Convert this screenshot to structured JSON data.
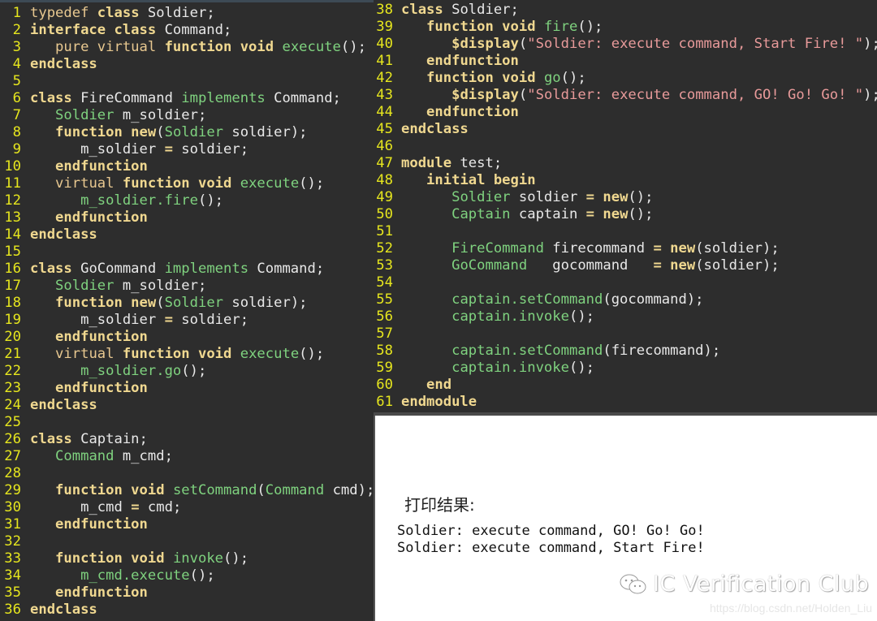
{
  "left_code": [
    {
      "n": "1",
      "parts": [
        {
          "c": "kw2",
          "t": "typedef "
        },
        {
          "c": "kw",
          "t": "class"
        },
        {
          "c": "plain",
          "t": " Soldier;"
        }
      ]
    },
    {
      "n": "2",
      "parts": [
        {
          "c": "kw",
          "t": "interface class"
        },
        {
          "c": "plain",
          "t": " Command;"
        }
      ]
    },
    {
      "n": "3",
      "parts": [
        {
          "c": "plain",
          "t": "   "
        },
        {
          "c": "kw2",
          "t": "pure virtual "
        },
        {
          "c": "kw",
          "t": "function void"
        },
        {
          "c": "plain",
          "t": " "
        },
        {
          "c": "fn",
          "t": "execute"
        },
        {
          "c": "plain",
          "t": "();"
        }
      ]
    },
    {
      "n": "4",
      "parts": [
        {
          "c": "kw",
          "t": "endclass"
        }
      ]
    },
    {
      "n": "5",
      "parts": []
    },
    {
      "n": "6",
      "parts": [
        {
          "c": "kw",
          "t": "class"
        },
        {
          "c": "plain",
          "t": " FireCommand "
        },
        {
          "c": "ty",
          "t": "implements"
        },
        {
          "c": "plain",
          "t": " Command;"
        }
      ]
    },
    {
      "n": "7",
      "parts": [
        {
          "c": "plain",
          "t": "   "
        },
        {
          "c": "ty",
          "t": "Soldier"
        },
        {
          "c": "plain",
          "t": " m_soldier;"
        }
      ]
    },
    {
      "n": "8",
      "parts": [
        {
          "c": "plain",
          "t": "   "
        },
        {
          "c": "kw",
          "t": "function new"
        },
        {
          "c": "plain",
          "t": "("
        },
        {
          "c": "ty",
          "t": "Soldier"
        },
        {
          "c": "plain",
          "t": " soldier);"
        }
      ]
    },
    {
      "n": "9",
      "parts": [
        {
          "c": "plain",
          "t": "      m_soldier "
        },
        {
          "c": "kw",
          "t": "="
        },
        {
          "c": "plain",
          "t": " soldier;"
        }
      ]
    },
    {
      "n": "10",
      "parts": [
        {
          "c": "plain",
          "t": "   "
        },
        {
          "c": "kw",
          "t": "endfunction"
        }
      ]
    },
    {
      "n": "11",
      "parts": [
        {
          "c": "plain",
          "t": "   "
        },
        {
          "c": "kw2",
          "t": "virtual "
        },
        {
          "c": "kw",
          "t": "function void"
        },
        {
          "c": "plain",
          "t": " "
        },
        {
          "c": "fn",
          "t": "execute"
        },
        {
          "c": "plain",
          "t": "();"
        }
      ]
    },
    {
      "n": "12",
      "parts": [
        {
          "c": "plain",
          "t": "      "
        },
        {
          "c": "fn",
          "t": "m_soldier.fire"
        },
        {
          "c": "plain",
          "t": "();"
        }
      ]
    },
    {
      "n": "13",
      "parts": [
        {
          "c": "plain",
          "t": "   "
        },
        {
          "c": "kw",
          "t": "endfunction"
        }
      ]
    },
    {
      "n": "14",
      "parts": [
        {
          "c": "kw",
          "t": "endclass"
        }
      ]
    },
    {
      "n": "15",
      "parts": []
    },
    {
      "n": "16",
      "parts": [
        {
          "c": "kw",
          "t": "class"
        },
        {
          "c": "plain",
          "t": " GoCommand "
        },
        {
          "c": "ty",
          "t": "implements"
        },
        {
          "c": "plain",
          "t": " Command;"
        }
      ]
    },
    {
      "n": "17",
      "parts": [
        {
          "c": "plain",
          "t": "   "
        },
        {
          "c": "ty",
          "t": "Soldier"
        },
        {
          "c": "plain",
          "t": " m_soldier;"
        }
      ]
    },
    {
      "n": "18",
      "parts": [
        {
          "c": "plain",
          "t": "   "
        },
        {
          "c": "kw",
          "t": "function new"
        },
        {
          "c": "plain",
          "t": "("
        },
        {
          "c": "ty",
          "t": "Soldier"
        },
        {
          "c": "plain",
          "t": " soldier);"
        }
      ]
    },
    {
      "n": "19",
      "parts": [
        {
          "c": "plain",
          "t": "      m_soldier "
        },
        {
          "c": "kw",
          "t": "="
        },
        {
          "c": "plain",
          "t": " soldier;"
        }
      ]
    },
    {
      "n": "20",
      "parts": [
        {
          "c": "plain",
          "t": "   "
        },
        {
          "c": "kw",
          "t": "endfunction"
        }
      ]
    },
    {
      "n": "21",
      "parts": [
        {
          "c": "plain",
          "t": "   "
        },
        {
          "c": "kw2",
          "t": "virtual "
        },
        {
          "c": "kw",
          "t": "function void"
        },
        {
          "c": "plain",
          "t": " "
        },
        {
          "c": "fn",
          "t": "execute"
        },
        {
          "c": "plain",
          "t": "();"
        }
      ]
    },
    {
      "n": "22",
      "parts": [
        {
          "c": "plain",
          "t": "      "
        },
        {
          "c": "fn",
          "t": "m_soldier.go"
        },
        {
          "c": "plain",
          "t": "();"
        }
      ]
    },
    {
      "n": "23",
      "parts": [
        {
          "c": "plain",
          "t": "   "
        },
        {
          "c": "kw",
          "t": "endfunction"
        }
      ]
    },
    {
      "n": "24",
      "parts": [
        {
          "c": "kw",
          "t": "endclass"
        }
      ]
    },
    {
      "n": "25",
      "parts": []
    },
    {
      "n": "26",
      "parts": [
        {
          "c": "kw",
          "t": "class"
        },
        {
          "c": "plain",
          "t": " Captain;"
        }
      ]
    },
    {
      "n": "27",
      "parts": [
        {
          "c": "plain",
          "t": "   "
        },
        {
          "c": "ty",
          "t": "Command"
        },
        {
          "c": "plain",
          "t": " m_cmd;"
        }
      ]
    },
    {
      "n": "28",
      "parts": []
    },
    {
      "n": "29",
      "parts": [
        {
          "c": "plain",
          "t": "   "
        },
        {
          "c": "kw",
          "t": "function void"
        },
        {
          "c": "plain",
          "t": " "
        },
        {
          "c": "fn",
          "t": "setCommand"
        },
        {
          "c": "plain",
          "t": "("
        },
        {
          "c": "ty",
          "t": "Command"
        },
        {
          "c": "plain",
          "t": " cmd);"
        }
      ]
    },
    {
      "n": "30",
      "parts": [
        {
          "c": "plain",
          "t": "      m_cmd "
        },
        {
          "c": "kw",
          "t": "="
        },
        {
          "c": "plain",
          "t": " cmd;"
        }
      ]
    },
    {
      "n": "31",
      "parts": [
        {
          "c": "plain",
          "t": "   "
        },
        {
          "c": "kw",
          "t": "endfunction"
        }
      ]
    },
    {
      "n": "32",
      "parts": []
    },
    {
      "n": "33",
      "parts": [
        {
          "c": "plain",
          "t": "   "
        },
        {
          "c": "kw",
          "t": "function void"
        },
        {
          "c": "plain",
          "t": " "
        },
        {
          "c": "fn",
          "t": "invoke"
        },
        {
          "c": "plain",
          "t": "();"
        }
      ]
    },
    {
      "n": "34",
      "parts": [
        {
          "c": "plain",
          "t": "      "
        },
        {
          "c": "fn",
          "t": "m_cmd.execute"
        },
        {
          "c": "plain",
          "t": "();"
        }
      ]
    },
    {
      "n": "35",
      "parts": [
        {
          "c": "plain",
          "t": "   "
        },
        {
          "c": "kw",
          "t": "endfunction"
        }
      ]
    },
    {
      "n": "36",
      "parts": [
        {
          "c": "kw",
          "t": "endclass"
        }
      ]
    }
  ],
  "right_code": [
    {
      "n": "38",
      "parts": [
        {
          "c": "kw",
          "t": "class"
        },
        {
          "c": "plain",
          "t": " Soldier;"
        }
      ]
    },
    {
      "n": "39",
      "parts": [
        {
          "c": "plain",
          "t": "   "
        },
        {
          "c": "kw",
          "t": "function void"
        },
        {
          "c": "plain",
          "t": " "
        },
        {
          "c": "fn",
          "t": "fire"
        },
        {
          "c": "plain",
          "t": "();"
        }
      ]
    },
    {
      "n": "40",
      "parts": [
        {
          "c": "plain",
          "t": "      "
        },
        {
          "c": "kw",
          "t": "$display"
        },
        {
          "c": "plain",
          "t": "("
        },
        {
          "c": "str",
          "t": "\"Soldier: execute command, Start Fire! \""
        },
        {
          "c": "plain",
          "t": ");"
        }
      ]
    },
    {
      "n": "41",
      "parts": [
        {
          "c": "plain",
          "t": "   "
        },
        {
          "c": "kw",
          "t": "endfunction"
        }
      ]
    },
    {
      "n": "42",
      "parts": [
        {
          "c": "plain",
          "t": "   "
        },
        {
          "c": "kw",
          "t": "function void"
        },
        {
          "c": "plain",
          "t": " "
        },
        {
          "c": "fn",
          "t": "go"
        },
        {
          "c": "plain",
          "t": "();"
        }
      ]
    },
    {
      "n": "43",
      "parts": [
        {
          "c": "plain",
          "t": "      "
        },
        {
          "c": "kw",
          "t": "$display"
        },
        {
          "c": "plain",
          "t": "("
        },
        {
          "c": "str",
          "t": "\"Soldier: execute command, GO! Go! Go! \""
        },
        {
          "c": "plain",
          "t": ");"
        }
      ]
    },
    {
      "n": "44",
      "parts": [
        {
          "c": "plain",
          "t": "   "
        },
        {
          "c": "kw",
          "t": "endfunction"
        }
      ]
    },
    {
      "n": "45",
      "parts": [
        {
          "c": "kw",
          "t": "endclass"
        }
      ]
    },
    {
      "n": "46",
      "parts": []
    },
    {
      "n": "47",
      "parts": [
        {
          "c": "kw",
          "t": "module"
        },
        {
          "c": "plain",
          "t": " test;"
        }
      ]
    },
    {
      "n": "48",
      "parts": [
        {
          "c": "plain",
          "t": "   "
        },
        {
          "c": "kw",
          "t": "initial begin"
        }
      ]
    },
    {
      "n": "49",
      "parts": [
        {
          "c": "plain",
          "t": "      "
        },
        {
          "c": "ty",
          "t": "Soldier"
        },
        {
          "c": "plain",
          "t": " soldier "
        },
        {
          "c": "kw",
          "t": "= new"
        },
        {
          "c": "plain",
          "t": "();"
        }
      ]
    },
    {
      "n": "50",
      "parts": [
        {
          "c": "plain",
          "t": "      "
        },
        {
          "c": "ty",
          "t": "Captain"
        },
        {
          "c": "plain",
          "t": " captain "
        },
        {
          "c": "kw",
          "t": "= new"
        },
        {
          "c": "plain",
          "t": "();"
        }
      ]
    },
    {
      "n": "51",
      "parts": []
    },
    {
      "n": "52",
      "parts": [
        {
          "c": "plain",
          "t": "      "
        },
        {
          "c": "ty",
          "t": "FireCommand"
        },
        {
          "c": "plain",
          "t": " firecommand "
        },
        {
          "c": "kw",
          "t": "= new"
        },
        {
          "c": "plain",
          "t": "(soldier);"
        }
      ]
    },
    {
      "n": "53",
      "parts": [
        {
          "c": "plain",
          "t": "      "
        },
        {
          "c": "ty",
          "t": "GoCommand"
        },
        {
          "c": "plain",
          "t": "   gocommand   "
        },
        {
          "c": "kw",
          "t": "= new"
        },
        {
          "c": "plain",
          "t": "(soldier);"
        }
      ]
    },
    {
      "n": "54",
      "parts": []
    },
    {
      "n": "55",
      "parts": [
        {
          "c": "plain",
          "t": "      "
        },
        {
          "c": "fn",
          "t": "captain.setCommand"
        },
        {
          "c": "plain",
          "t": "(gocommand);"
        }
      ]
    },
    {
      "n": "56",
      "parts": [
        {
          "c": "plain",
          "t": "      "
        },
        {
          "c": "fn",
          "t": "captain.invoke"
        },
        {
          "c": "plain",
          "t": "();"
        }
      ]
    },
    {
      "n": "57",
      "parts": []
    },
    {
      "n": "58",
      "parts": [
        {
          "c": "plain",
          "t": "      "
        },
        {
          "c": "fn",
          "t": "captain.setCommand"
        },
        {
          "c": "plain",
          "t": "(firecommand);"
        }
      ]
    },
    {
      "n": "59",
      "parts": [
        {
          "c": "plain",
          "t": "      "
        },
        {
          "c": "fn",
          "t": "captain.invoke"
        },
        {
          "c": "plain",
          "t": "();"
        }
      ]
    },
    {
      "n": "60",
      "parts": [
        {
          "c": "plain",
          "t": "   "
        },
        {
          "c": "kw",
          "t": "end"
        }
      ]
    },
    {
      "n": "61",
      "parts": [
        {
          "c": "kw",
          "t": "endmodule"
        }
      ]
    }
  ],
  "output": {
    "title": "打印结果:",
    "lines": [
      "Soldier: execute command, GO! Go! Go!",
      "Soldier: execute command, Start Fire!"
    ]
  },
  "watermark": {
    "icon": "wechat-icon",
    "text": "IC Verification Club",
    "url": "https://blog.csdn.net/Holden_Liu"
  },
  "colors": {
    "background": "#2d2d2d",
    "line_number": "#e6e61e",
    "keyword": "#f0d890",
    "type_function": "#7fd27f",
    "string": "#e89a9a"
  }
}
